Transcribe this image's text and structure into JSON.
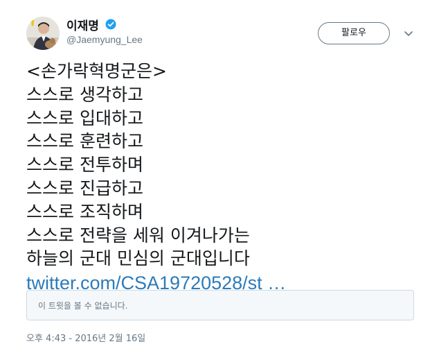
{
  "author": {
    "display_name": "이재명",
    "handle": "@Jaemyung_Lee",
    "verified": true
  },
  "header": {
    "follow_label": "팔로우",
    "menu_icon": "chevron-down-icon"
  },
  "tweet": {
    "lines": [
      "<손가락혁명군은>",
      "스스로 생각하고",
      "스스로 입대하고",
      "스스로 훈련하고",
      "스스로 전투하며",
      "스스로 진급하고",
      "스스로 조직하며",
      "스스로 전략을 세워 이겨나가는",
      "하늘의 군대 민심의 군대입니다"
    ],
    "link": "twitter.com/CSA19720528/st …"
  },
  "quoted_tweet": {
    "unavailable_text": "이 트윗을 볼 수 없습니다."
  },
  "timestamp": "오후 4:43 - 2016년 2월 16일",
  "colors": {
    "link": "#2b7bb9",
    "secondary_text": "#657786",
    "verified": "#1da1f2",
    "quote_background": "#f5f8fa"
  }
}
